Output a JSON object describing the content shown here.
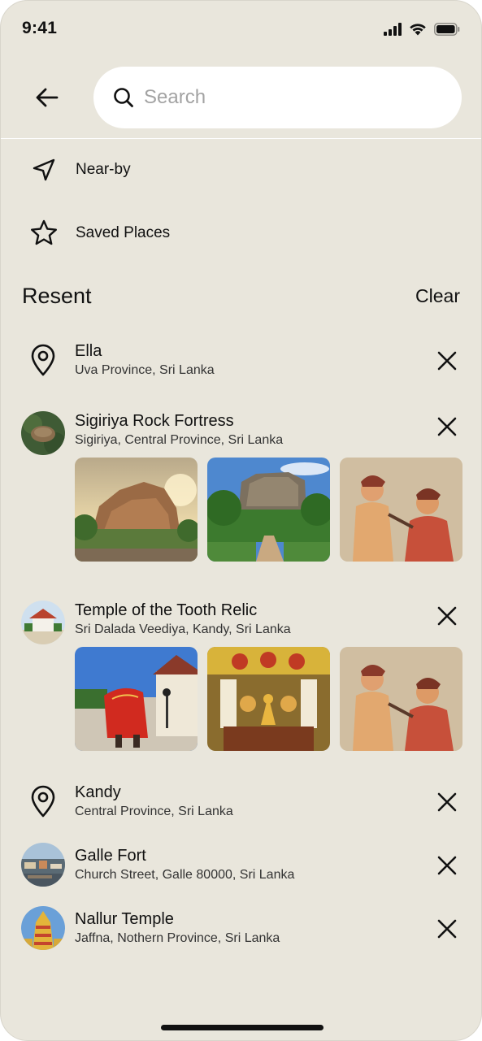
{
  "status_bar": {
    "time": "9:41"
  },
  "search": {
    "placeholder": "Search"
  },
  "quick_items": [
    {
      "label": "Near-by",
      "icon": "navigation-arrow-icon"
    },
    {
      "label": "Saved Places",
      "icon": "star-icon"
    }
  ],
  "recent": {
    "title": "Resent",
    "clear_label": "Clear",
    "items": [
      {
        "title": "Ella",
        "subtitle": "Uva Province, Sri Lanka",
        "icon": "map-pin-icon"
      },
      {
        "title": "Sigiriya Rock Fortress",
        "subtitle": "Sigiriya, Central Province, Sri Lanka",
        "icon": "place-thumbnail"
      },
      {
        "title": "Temple of the Tooth Relic",
        "subtitle": "Sri Dalada Veediya, Kandy, Sri Lanka",
        "icon": "place-thumbnail"
      },
      {
        "title": "Kandy",
        "subtitle": "Central Province, Sri Lanka",
        "icon": "map-pin-icon"
      },
      {
        "title": "Galle Fort",
        "subtitle": "Church Street, Galle 80000, Sri Lanka",
        "icon": "place-thumbnail"
      },
      {
        "title": "Nallur Temple",
        "subtitle": "Jaffna, Nothern Province, Sri Lanka",
        "icon": "place-thumbnail"
      }
    ]
  },
  "colors": {
    "background": "#e9e6dc",
    "search_bg": "#ffffff",
    "text": "#111111",
    "placeholder": "#a3a3a3"
  }
}
